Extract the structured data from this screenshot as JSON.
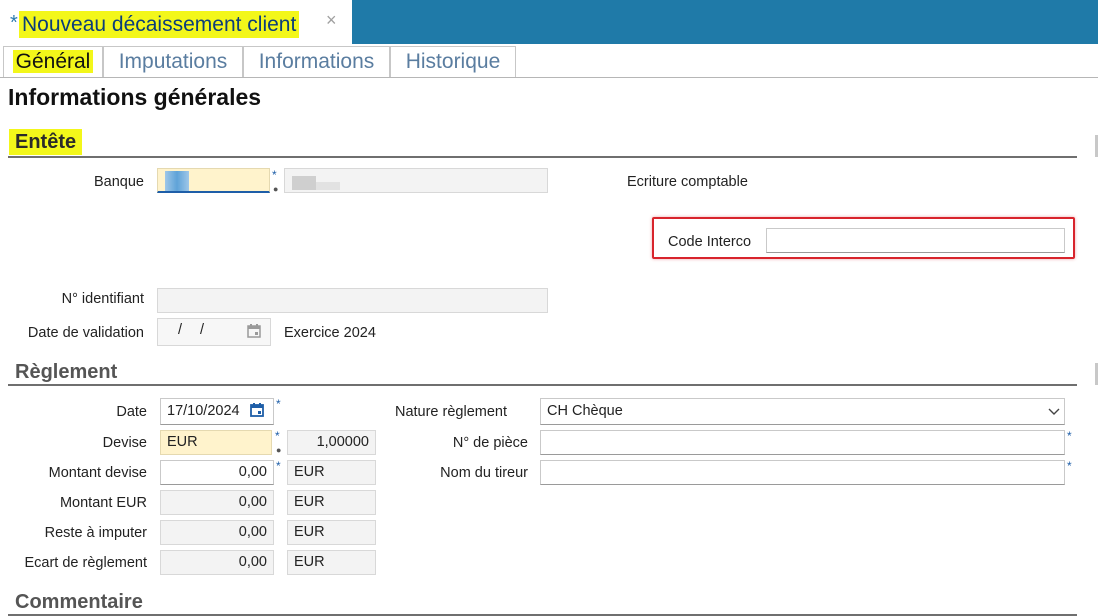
{
  "window": {
    "modified_marker": "*",
    "title": "Nouveau décaissement client",
    "close_glyph": "×"
  },
  "tabs": [
    {
      "label": "Général",
      "active": true
    },
    {
      "label": "Imputations",
      "active": false
    },
    {
      "label": "Informations",
      "active": false
    },
    {
      "label": "Historique",
      "active": false
    }
  ],
  "page_title": "Informations générales",
  "entete": {
    "heading": "Entête",
    "banque_label": "Banque",
    "ecriture_label": "Ecriture comptable",
    "code_interco_label": "Code Interco",
    "code_interco_value": "",
    "identifiant_label": "N° identifiant",
    "identifiant_value": "",
    "date_validation_label": "Date de validation",
    "date_validation_value": "/ /",
    "exercice_text": "Exercice 2024"
  },
  "reglement": {
    "heading": "Règlement",
    "date_label": "Date",
    "date_value": "17/10/2024",
    "devise_label": "Devise",
    "devise_value": "EUR",
    "taux_value": "1,00000",
    "montant_devise_label": "Montant devise",
    "montant_devise_value": "0,00",
    "montant_devise_currency": "EUR",
    "montant_eur_label": "Montant EUR",
    "montant_eur_value": "0,00",
    "montant_eur_currency": "EUR",
    "reste_label": "Reste à imputer",
    "reste_value": "0,00",
    "reste_currency": "EUR",
    "ecart_label": "Ecart de règlement",
    "ecart_value": "0,00",
    "ecart_currency": "EUR",
    "nature_label": "Nature règlement",
    "nature_value": "CH Chèque",
    "piece_label": "N° de pièce",
    "piece_value": "",
    "tireur_label": "Nom du tireur",
    "tireur_value": ""
  },
  "commentaire": {
    "heading": "Commentaire"
  },
  "required_marker": "*",
  "colors": {
    "accent": "#1f7aa8",
    "highlight": "#f3f71a",
    "focus_box": "#d8242c"
  }
}
